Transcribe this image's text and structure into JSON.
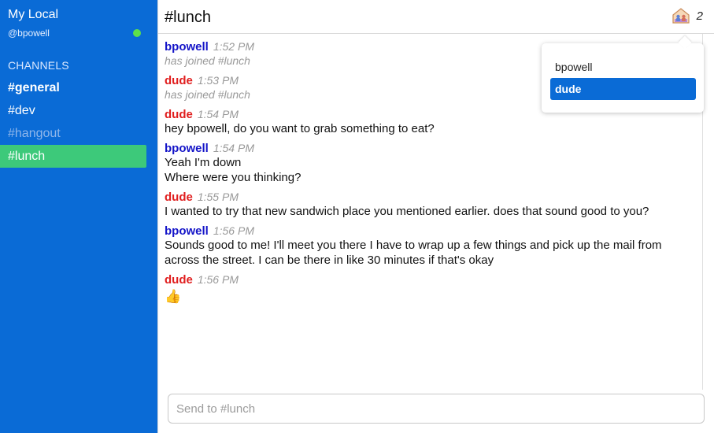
{
  "sidebar": {
    "workspace": "My Local",
    "user": "@bpowell",
    "channels_header": "CHANNELS",
    "channels": [
      {
        "label": "#general"
      },
      {
        "label": "#dev"
      },
      {
        "label": "#hangout"
      },
      {
        "label": "#lunch"
      }
    ]
  },
  "header": {
    "channel_title": "#lunch",
    "members_count": "2"
  },
  "messages": [
    {
      "author": "bpowell",
      "time": "1:52 PM",
      "lines": [
        "has joined #lunch"
      ]
    },
    {
      "author": "dude",
      "time": "1:53 PM",
      "lines": [
        "has joined #lunch"
      ]
    },
    {
      "author": "dude",
      "time": "1:54 PM",
      "lines": [
        "hey bpowell, do you want to grab something to eat?"
      ]
    },
    {
      "author": "bpowell",
      "time": "1:54 PM",
      "lines": [
        "Yeah I'm down",
        "Where were you thinking?"
      ]
    },
    {
      "author": "dude",
      "time": "1:55 PM",
      "lines": [
        "I wanted to try that new sandwich place you mentioned earlier. does that sound good to you?"
      ]
    },
    {
      "author": "bpowell",
      "time": "1:56 PM",
      "lines": [
        "Sounds good to me! I'll meet you there I have to wrap up a few things and pick up the mail from",
        "across the street. I can be there in like 30 minutes if that's okay"
      ]
    },
    {
      "author": "dude",
      "time": "1:56 PM",
      "lines": [
        "👍"
      ]
    }
  ],
  "members_popover": {
    "items": [
      {
        "label": "bpowell"
      },
      {
        "label": "dude"
      }
    ]
  },
  "composer": {
    "placeholder": "Send to #lunch"
  },
  "colors": {
    "sidebar": "#0a6bd6",
    "active_channel": "#3dc97a",
    "online": "#5ee04a",
    "author_bpowell": "#1414c8",
    "author_dude": "#e01e1e"
  }
}
